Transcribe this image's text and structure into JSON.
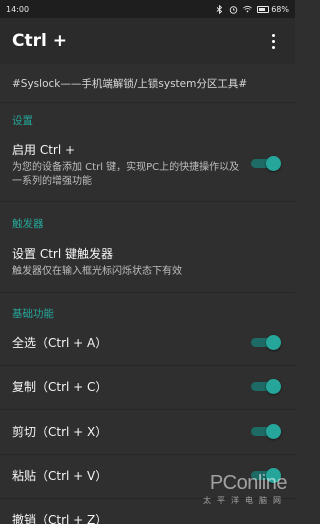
{
  "status_bar": {
    "time": "14:00",
    "icons": [
      "bluetooth-icon",
      "alarm-icon",
      "wifi-icon",
      "battery-icon"
    ],
    "battery_percent": "68%",
    "battery_level": 0.68
  },
  "app_bar": {
    "title": "Ctrl +",
    "menu_icon": "more-vert-icon"
  },
  "banner": "#Syslock——手机端解锁/上锁system分区工具#",
  "sections": {
    "settings": {
      "header": "设置",
      "enable": {
        "title": "启用 Ctrl +",
        "summary": "为您的设备添加 Ctrl 键，实现PC上的快捷操作以及一系列的增强功能",
        "checked": true
      }
    },
    "trigger": {
      "header": "触发器",
      "set_trigger": {
        "title": "设置 Ctrl 键触发器",
        "summary": "触发器仅在输入框光标闪烁状态下有效"
      }
    },
    "basic": {
      "header": "基础功能",
      "items": [
        {
          "title": "全选（Ctrl + A）",
          "checked": true
        },
        {
          "title": "复制（Ctrl + C）",
          "checked": true
        },
        {
          "title": "剪切（Ctrl + X）",
          "checked": true
        },
        {
          "title": "粘贴（Ctrl + V）",
          "checked": true
        },
        {
          "title": "撤销（Ctrl + Z）",
          "checked": true
        }
      ]
    }
  },
  "watermark": {
    "logo": "PConline",
    "sub": "太平洋电脑网"
  },
  "colors": {
    "accent": "#26a69a",
    "background": "#2f2f2f",
    "app_bar": "#2b2b2b",
    "status_bar": "#1e1e1e"
  }
}
